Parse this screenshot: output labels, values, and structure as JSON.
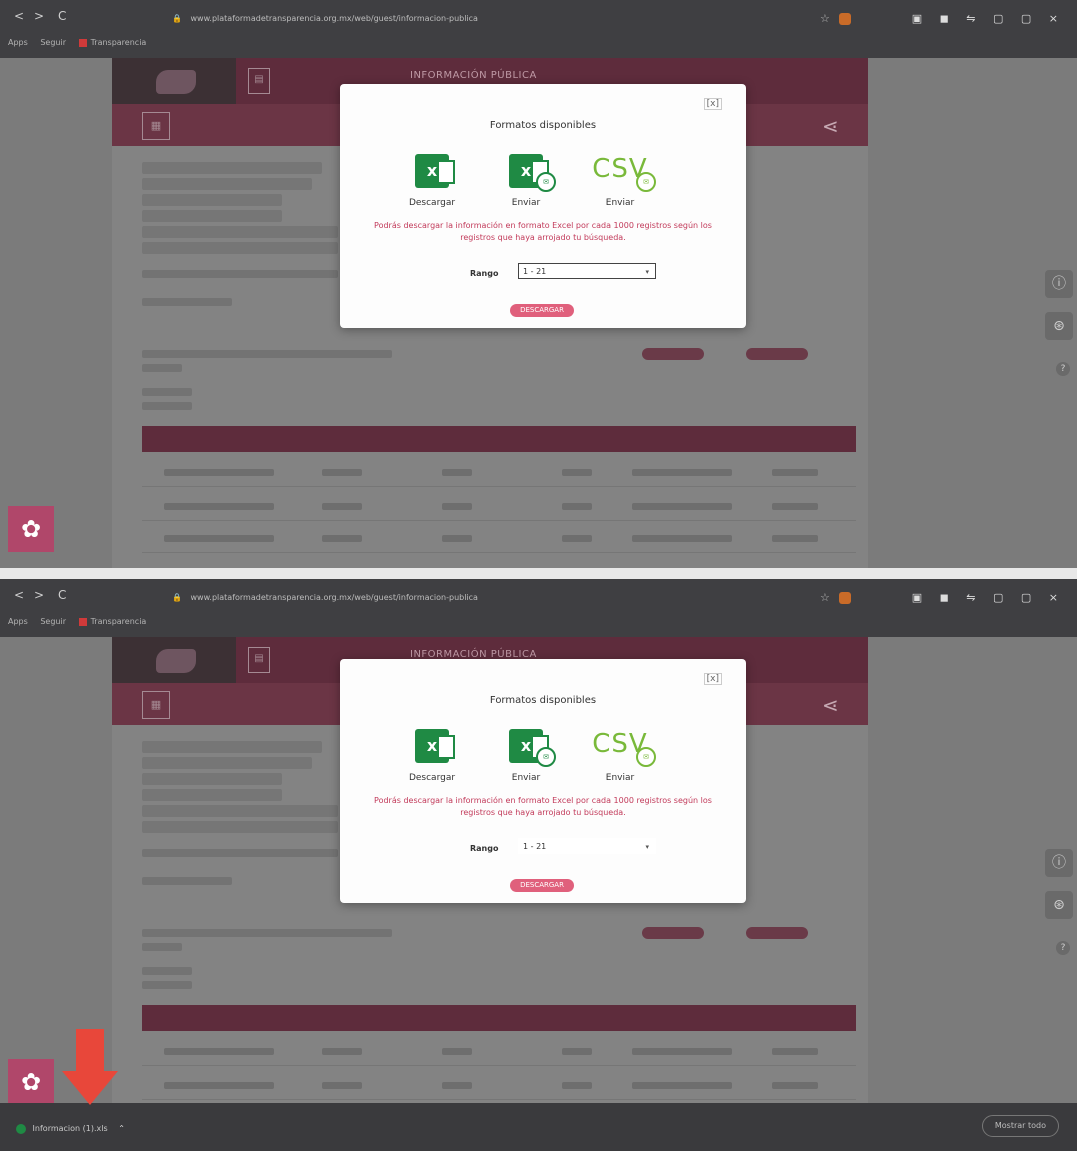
{
  "browser": {
    "url": "www.plataformadetransparencia.org.mx/web/guest/informacion-publica",
    "nav_back": "<",
    "nav_forward": ">",
    "nav_reload": "C",
    "window_controls": "▣ ◼ ⇋ ▢ ▢ ×",
    "bookmarks": [
      "Apps",
      "Seguir",
      "Transparencia"
    ]
  },
  "site": {
    "section_title": "INFORMACIÓN PÚBLICA"
  },
  "modal": {
    "title": "Formatos disponibles",
    "close_label": "[x]",
    "formats": [
      {
        "label": "Descargar",
        "icon": "excel-icon"
      },
      {
        "label": "Enviar",
        "icon": "excel-send-icon"
      },
      {
        "label": "Enviar",
        "icon": "csv-send-icon"
      }
    ],
    "csv_text": "CSV",
    "note": "Podrás descargar la información en formato Excel por cada 1000 registros según los registros que haya arrojado tu búsqueda.",
    "range_label": "Rango",
    "range_value": "1 - 21",
    "action_label": "DESCARGAR"
  },
  "downloads": {
    "file_label": "Informacion (1).xls",
    "show_all": "Mostrar todo"
  },
  "colors": {
    "brand_maroon": "#5e2c3c",
    "excel_green": "#1f8a44",
    "csv_green": "#79b93a",
    "note_red": "#c23a5a",
    "button_pink": "#e0607c",
    "arrow_red": "#e8473a"
  }
}
